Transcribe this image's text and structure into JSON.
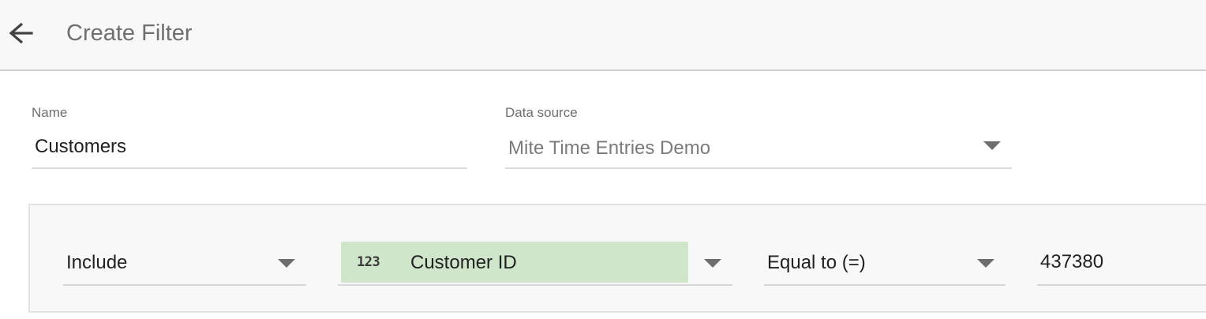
{
  "header": {
    "back_icon": "arrow-left-icon",
    "title": "Create Filter"
  },
  "form": {
    "name": {
      "label": "Name",
      "value": "Customers"
    },
    "data_source": {
      "label": "Data source",
      "value": "Mite Time Entries Demo",
      "dropdown_icon": "caret-down-icon"
    }
  },
  "condition": {
    "include_select": "Include",
    "field": {
      "type_icon_text": "123",
      "type_icon": "numeric-type-icon",
      "label": "Customer ID",
      "chip_color": "#cfe6cb"
    },
    "operator": "Equal to (=)",
    "value": "437380"
  },
  "colors": {
    "header_bg": "#f8f8f8",
    "panel_bg": "#f8f8f8",
    "title_text": "#6f6f6f",
    "field_chip": "#cfe6cb"
  }
}
